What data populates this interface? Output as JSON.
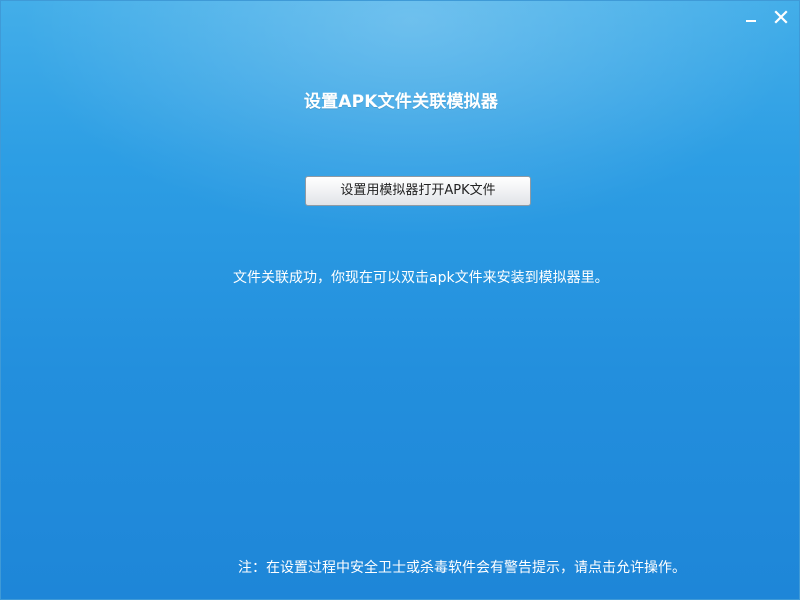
{
  "window": {
    "controls": {
      "minimize_icon": "minimize-icon",
      "close_icon": "close-icon"
    }
  },
  "main": {
    "title": "设置APK文件关联模拟器",
    "button_label": "设置用模拟器打开APK文件",
    "status_message": "文件关联成功，你现在可以双击apk文件来安装到模拟器里。",
    "footer_note": "注：在设置过程中安全卫士或杀毒软件会有警告提示，请点击允许操作。"
  },
  "colors": {
    "background_top": "#43aee9",
    "background_bottom": "#1e86d8",
    "text": "#ffffff",
    "button_text": "#222222",
    "button_border": "#8f9aa4"
  }
}
